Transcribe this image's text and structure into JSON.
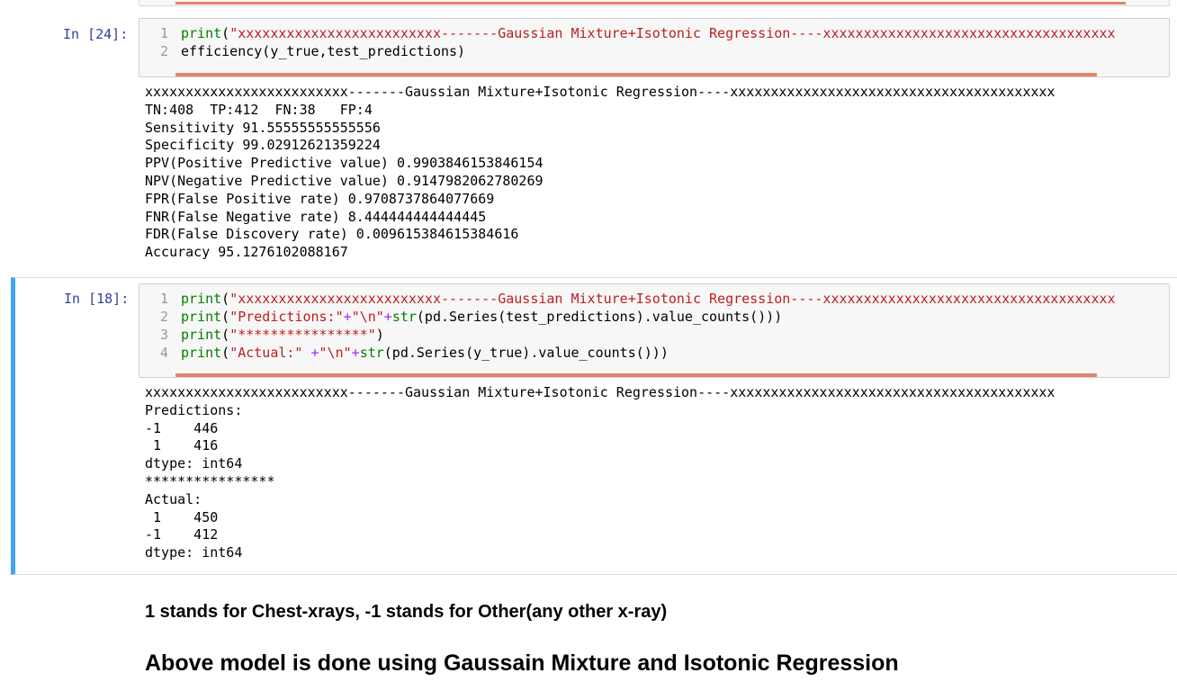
{
  "cell_24": {
    "prompt": "In [24]:",
    "lines": [
      {
        "num": "1",
        "parts": [
          {
            "t": "print",
            "c": "kw"
          },
          {
            "t": "(",
            "c": ""
          },
          {
            "t": "\"xxxxxxxxxxxxxxxxxxxxxxxxx-------Gaussian Mixture+Isotonic Regression----xxxxxxxxxxxxxxxxxxxxxxxxxxxxxxxxxxxx",
            "c": "str"
          }
        ]
      },
      {
        "num": "2",
        "parts": [
          {
            "t": "efficiency(y_true,test_predictions)",
            "c": ""
          }
        ]
      }
    ],
    "output": [
      "xxxxxxxxxxxxxxxxxxxxxxxxx-------Gaussian Mixture+Isotonic Regression----xxxxxxxxxxxxxxxxxxxxxxxxxxxxxxxxxxxxxxxx",
      "TN:408  TP:412  FN:38   FP:4",
      "Sensitivity 91.55555555555556",
      "Specificity 99.02912621359224",
      "PPV(Positive Predictive value) 0.9903846153846154",
      "NPV(Negative Predictive value) 0.9147982062780269",
      "FPR(False Positive rate) 0.9708737864077669",
      "FNR(False Negative rate) 8.444444444444445",
      "FDR(False Discovery rate) 0.009615384615384616",
      "Accuracy 95.1276102088167"
    ]
  },
  "cell_18": {
    "prompt": "In [18]:",
    "lines": [
      {
        "num": "1",
        "parts": [
          {
            "t": "print",
            "c": "kw"
          },
          {
            "t": "(",
            "c": ""
          },
          {
            "t": "\"xxxxxxxxxxxxxxxxxxxxxxxxx-------Gaussian Mixture+Isotonic Regression----xxxxxxxxxxxxxxxxxxxxxxxxxxxxxxxxxxxx",
            "c": "str"
          }
        ]
      },
      {
        "num": "2",
        "parts": [
          {
            "t": "print",
            "c": "kw"
          },
          {
            "t": "(",
            "c": ""
          },
          {
            "t": "\"Predictions:\"",
            "c": "str"
          },
          {
            "t": "+",
            "c": "op"
          },
          {
            "t": "\"\\n\"",
            "c": "str"
          },
          {
            "t": "+",
            "c": "op"
          },
          {
            "t": "str",
            "c": "kw"
          },
          {
            "t": "(pd.Series(test_predictions).value_counts()))",
            "c": ""
          }
        ]
      },
      {
        "num": "3",
        "parts": [
          {
            "t": "print",
            "c": "kw"
          },
          {
            "t": "(",
            "c": ""
          },
          {
            "t": "\"****************\"",
            "c": "str"
          },
          {
            "t": ")",
            "c": ""
          }
        ]
      },
      {
        "num": "4",
        "parts": [
          {
            "t": "print",
            "c": "kw"
          },
          {
            "t": "(",
            "c": ""
          },
          {
            "t": "\"Actual:\"",
            "c": "str"
          },
          {
            "t": " ",
            "c": ""
          },
          {
            "t": "+",
            "c": "op"
          },
          {
            "t": "\"\\n\"",
            "c": "str"
          },
          {
            "t": "+",
            "c": "op"
          },
          {
            "t": "str",
            "c": "kw"
          },
          {
            "t": "(pd.Series(y_true).value_counts()))",
            "c": ""
          }
        ]
      }
    ],
    "output": [
      "xxxxxxxxxxxxxxxxxxxxxxxxx-------Gaussian Mixture+Isotonic Regression----xxxxxxxxxxxxxxxxxxxxxxxxxxxxxxxxxxxxxxxx",
      "Predictions:",
      "-1    446",
      " 1    416",
      "dtype: int64",
      "****************",
      "Actual:",
      " 1    450",
      "-1    412",
      "dtype: int64"
    ]
  },
  "markdown": {
    "note": "1 stands for Chest-xrays, -1 stands for Other(any other x-ray)",
    "heading": "Above model is done using Gaussain Mixture and Isotonic Regression"
  },
  "colors": {
    "keyword": "#008000",
    "string": "#ba2121",
    "operator": "#aa22ff",
    "prompt": "#303f9f",
    "selected_border": "#42a5f5",
    "scrollbar": "#e2856b"
  }
}
